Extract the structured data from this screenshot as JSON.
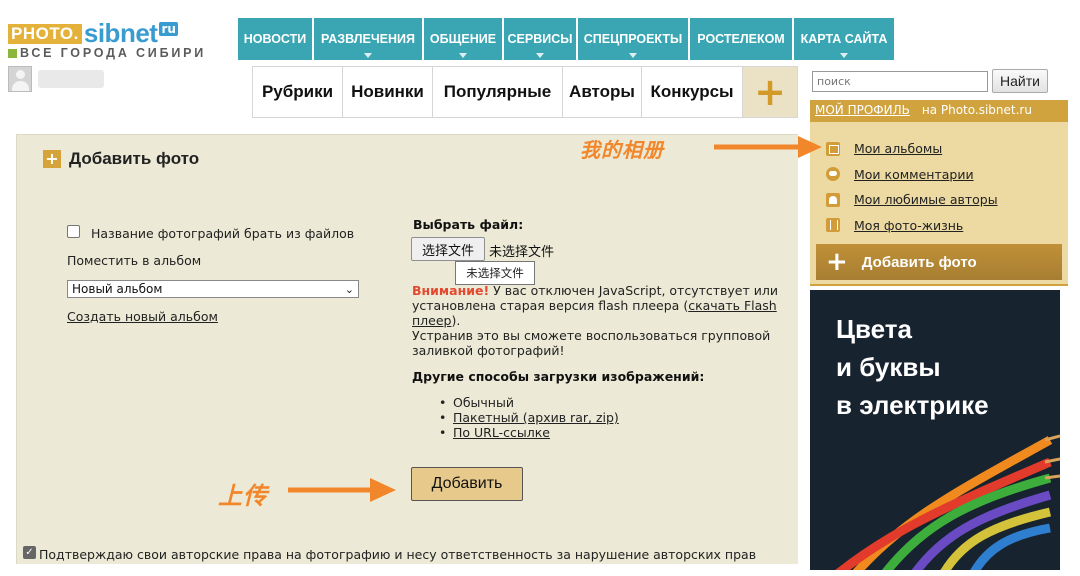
{
  "logo": {
    "photo": "PHOTO.",
    "brand": "sibnet",
    "tld": "ru",
    "tagline": "ВСЕ ГОРОДА СИБИРИ"
  },
  "top_nav": [
    {
      "label": "НОВОСТИ",
      "has_dropdown": false
    },
    {
      "label": "РАЗВЛЕЧЕНИЯ",
      "has_dropdown": true
    },
    {
      "label": "ОБЩЕНИЕ",
      "has_dropdown": true
    },
    {
      "label": "СЕРВИСЫ",
      "has_dropdown": true
    },
    {
      "label": "СПЕЦПРОЕКТЫ",
      "has_dropdown": true
    },
    {
      "label": "РОСТЕЛЕКОМ",
      "has_dropdown": false
    },
    {
      "label": "КАРТА САЙТА",
      "has_dropdown": true
    }
  ],
  "sub_nav": [
    "Рубрики",
    "Новинки",
    "Популярные",
    "Авторы",
    "Конкурсы"
  ],
  "sub_nav_plus": "+",
  "search": {
    "placeholder": "поиск",
    "button": "Найти"
  },
  "main": {
    "title": "Добавить фото",
    "filename_checkbox_label": "Название фотографий брать из файлов",
    "album_label": "Поместить в альбом",
    "album_select_value": "Новый альбом",
    "create_album_link": "Создать новый альбом",
    "file_label": "Выбрать файл:",
    "file_button": "选择文件",
    "file_status": "未选择文件",
    "file_tooltip": "未选择文件",
    "warning": {
      "strong": "Внимание!",
      "text1": " У вас отключен JavaScript, отсутствует или установлена старая версия flash плеера (",
      "link": "скачать Flash плеер",
      "text2": ").",
      "text3": "Устранив это вы сможете воспользоваться групповой заливкой фотографий!"
    },
    "other_methods_title": "Другие способы загрузки изображений:",
    "methods": [
      {
        "label": "Обычный",
        "link": false
      },
      {
        "label": "Пакетный (архив rar, zip)",
        "link": true
      },
      {
        "label": "По URL-ссылке",
        "link": true
      }
    ],
    "add_button": "Добавить",
    "rights_checkbox_label": "Подтверждаю свои авторские права на фотографию и несу ответственность за нарушение авторских прав",
    "rights_checkbox_checked": true
  },
  "profile": {
    "title": "МОЙ ПРОФИЛЬ",
    "domain": "на Photo.sibnet.ru",
    "items": [
      {
        "label": "Мои альбомы",
        "icon": "album-icon"
      },
      {
        "label": "Мои комментарии",
        "icon": "comment-icon"
      },
      {
        "label": "Мои любимые авторы",
        "icon": "favorite-authors-icon"
      },
      {
        "label": "Моя фото-жизнь",
        "icon": "photo-life-icon"
      }
    ],
    "add_photo": "Добавить фото"
  },
  "ad": {
    "lines": [
      "Цвета",
      "и буквы",
      "в электрике"
    ]
  },
  "annotations": {
    "albums": "我的相册",
    "upload": "上传"
  },
  "colors": {
    "nav_teal": "#3aa6b3",
    "panel_bg": "#ecead6",
    "accent_gold": "#d1a33f",
    "annotation_orange": "#f2862b",
    "warning_red": "#e2492f"
  }
}
